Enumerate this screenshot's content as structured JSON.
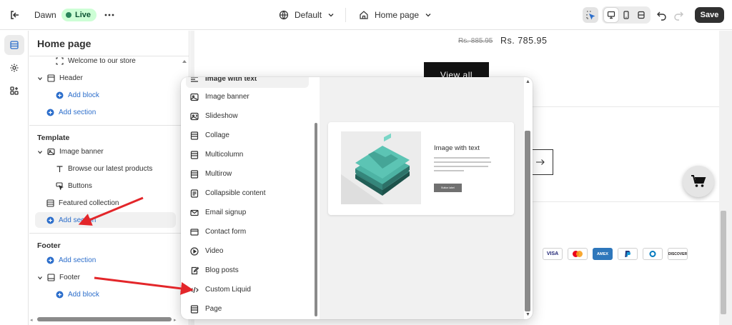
{
  "topbar": {
    "theme_name": "Dawn",
    "status": "Live",
    "theme_select": "Default",
    "page_select": "Home page",
    "save_label": "Save"
  },
  "sidebar": {
    "title": "Home page",
    "items": [
      {
        "label": "Welcome to our store"
      },
      {
        "label": "Header"
      },
      {
        "label": "Add block"
      },
      {
        "label": "Add section"
      }
    ],
    "template": {
      "heading": "Template",
      "items": [
        {
          "label": "Image banner"
        },
        {
          "label": "Browse our latest products"
        },
        {
          "label": "Buttons"
        },
        {
          "label": "Featured collection"
        },
        {
          "label": "Add section"
        }
      ]
    },
    "footer": {
      "heading": "Footer",
      "items": [
        {
          "label": "Add section"
        },
        {
          "label": "Footer"
        },
        {
          "label": "Add block"
        }
      ]
    }
  },
  "preview": {
    "price_old": "Rs. 885.95",
    "price_new": "Rs. 785.95",
    "view_all": "View all",
    "payment_icons": [
      "VISA",
      "mastercard",
      "amex",
      "paypal",
      "diners",
      "DISCOVER"
    ]
  },
  "picker": {
    "items": [
      {
        "label": "Image with text",
        "icon": "image-text-icon"
      },
      {
        "label": "Image banner",
        "icon": "image-banner-icon"
      },
      {
        "label": "Slideshow",
        "icon": "slideshow-icon"
      },
      {
        "label": "Collage",
        "icon": "collage-icon"
      },
      {
        "label": "Multicolumn",
        "icon": "multicolumn-icon"
      },
      {
        "label": "Multirow",
        "icon": "multirow-icon"
      },
      {
        "label": "Collapsible content",
        "icon": "collapsible-icon"
      },
      {
        "label": "Email signup",
        "icon": "email-icon"
      },
      {
        "label": "Contact form",
        "icon": "contact-form-icon"
      },
      {
        "label": "Video",
        "icon": "video-icon"
      },
      {
        "label": "Blog posts",
        "icon": "blog-icon"
      },
      {
        "label": "Custom Liquid",
        "icon": "code-icon"
      },
      {
        "label": "Page",
        "icon": "page-icon"
      }
    ],
    "preview_title": "Image with text",
    "preview_button": "Button label"
  },
  "colors": {
    "accent_blue": "#2c6ecb",
    "live_bg": "#cdfed5",
    "annotation_red": "#e3262a"
  }
}
